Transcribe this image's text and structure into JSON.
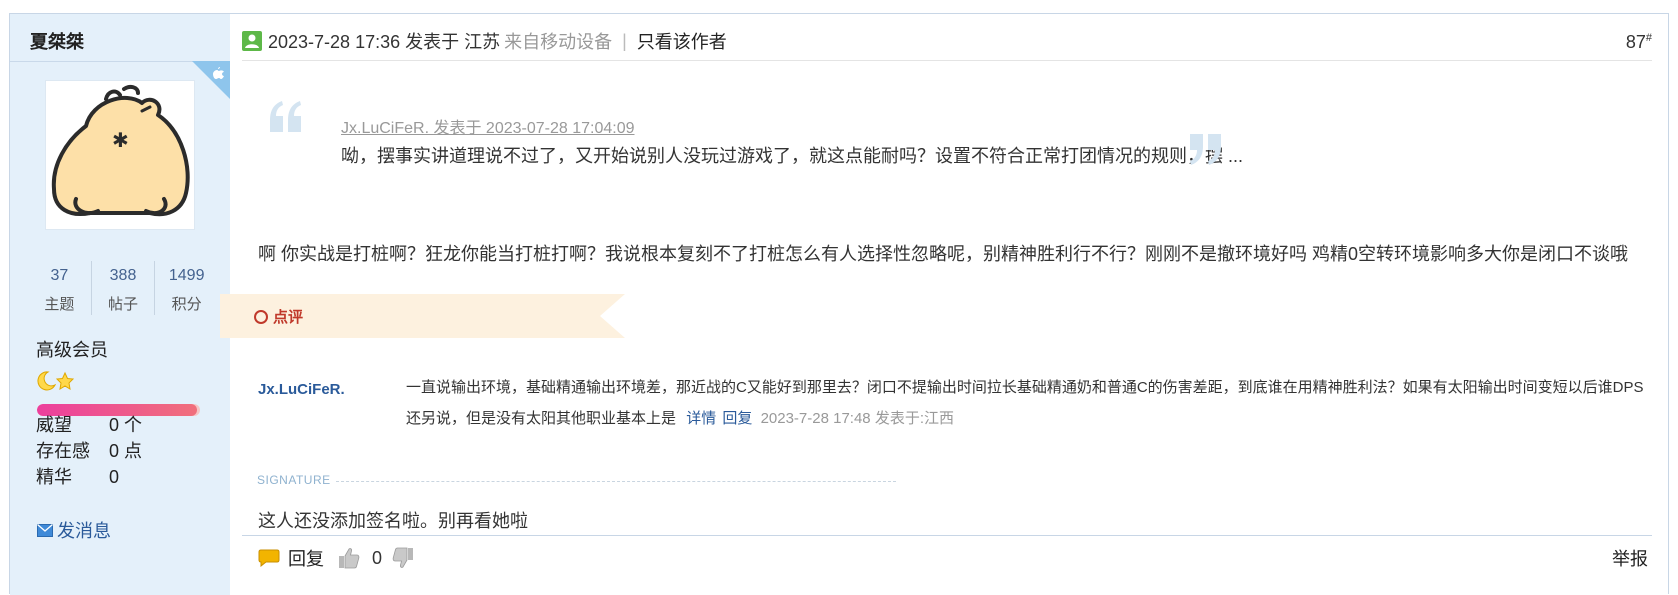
{
  "author": {
    "name": "夏桀桀",
    "stats": [
      {
        "value": "37",
        "label": "主题"
      },
      {
        "value": "388",
        "label": "帖子"
      },
      {
        "value": "1499",
        "label": "积分"
      }
    ],
    "group": "高级会员",
    "progress_fraction": 0.98,
    "props": [
      {
        "key": "威望",
        "value": "0 个"
      },
      {
        "key": "存在感",
        "value": "0 点"
      },
      {
        "key": "精华",
        "value": "0"
      }
    ],
    "send_message": "发消息"
  },
  "post": {
    "time": "2023-7-28 17:36 发表于 江苏",
    "from": "来自移动设备",
    "separator": "|",
    "only_author": "只看该作者",
    "floor": "87",
    "floor_suffix": "#",
    "quote": {
      "source": "Jx.LuCiFeR. 发表于 2023-07-28 17:04:09",
      "text": "呦，摆事实讲道理说不过了，又开始说别人没玩过游戏了，就这点能耐吗？设置不符合正常打团情况的规则，摆 ..."
    },
    "body": "啊 你实战是打桩啊？狂龙你能当打桩打啊？我说根本复刻不了打桩怎么有人选择性忽略呢，别精神胜利行不行？刚刚不是撤环境好吗 鸡精0空转环境影响多大你是闭口不谈哦",
    "comment_tag": "点评",
    "comment": {
      "author": "Jx.LuCiFeR.",
      "text": "一直说输出环境，基础精通输出环境差，那近战的C又能好到那里去？闭口不提输出时间拉长基础精通奶和普通C的伤害差距，到底谁在用精神胜利法？如果有太阳输出时间变短以后谁DPS还另说，但是没有太阳其他职业基本上是",
      "detail": "详情",
      "reply": "回复",
      "time": "2023-7-28 17:48 发表于:江西"
    },
    "signature_label": "SIGNATURE",
    "signature": "这人还没添加签名啦。别再看她啦"
  },
  "footer": {
    "reply": "回复",
    "support_count": "0",
    "report": "举报"
  },
  "colors": {
    "sidebar_bg": "#e4f0fa",
    "link": "#2a5a9a",
    "comment_tag_red": "#c0392b",
    "progress_pink": "#ec3f9d"
  },
  "icons": {
    "online": "online-status-icon",
    "moon": "moon-icon",
    "star": "star-icon",
    "mail": "mail-icon",
    "reply": "speech-bubble-icon",
    "thumb_up": "thumb-up-icon",
    "thumb_down": "thumb-down-icon",
    "quote_open": "quote-open-icon",
    "quote_close": "quote-close-icon",
    "apple": "apple-icon"
  }
}
